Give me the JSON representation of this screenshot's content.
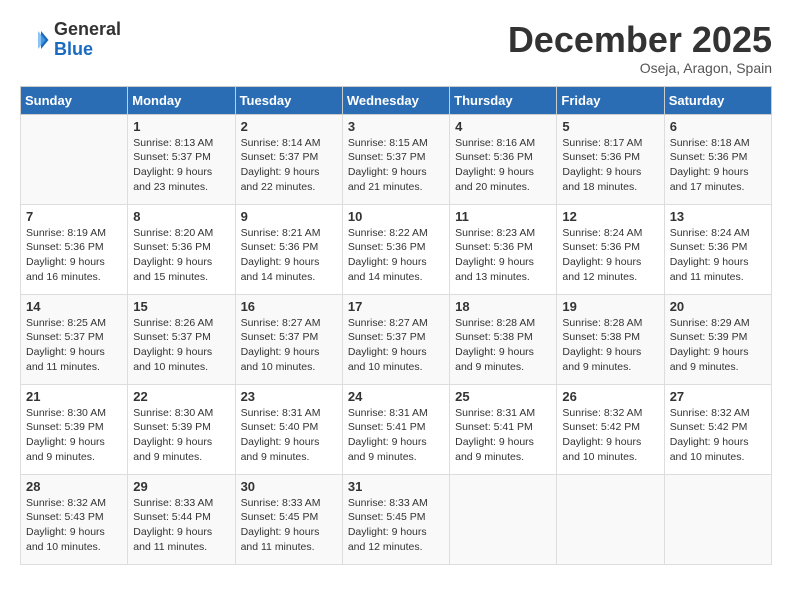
{
  "header": {
    "logo_general": "General",
    "logo_blue": "Blue",
    "month": "December 2025",
    "location": "Oseja, Aragon, Spain"
  },
  "days_of_week": [
    "Sunday",
    "Monday",
    "Tuesday",
    "Wednesday",
    "Thursday",
    "Friday",
    "Saturday"
  ],
  "weeks": [
    [
      {
        "day": "",
        "sunrise": "",
        "sunset": "",
        "daylight": ""
      },
      {
        "day": "1",
        "sunrise": "Sunrise: 8:13 AM",
        "sunset": "Sunset: 5:37 PM",
        "daylight": "Daylight: 9 hours and 23 minutes."
      },
      {
        "day": "2",
        "sunrise": "Sunrise: 8:14 AM",
        "sunset": "Sunset: 5:37 PM",
        "daylight": "Daylight: 9 hours and 22 minutes."
      },
      {
        "day": "3",
        "sunrise": "Sunrise: 8:15 AM",
        "sunset": "Sunset: 5:37 PM",
        "daylight": "Daylight: 9 hours and 21 minutes."
      },
      {
        "day": "4",
        "sunrise": "Sunrise: 8:16 AM",
        "sunset": "Sunset: 5:36 PM",
        "daylight": "Daylight: 9 hours and 20 minutes."
      },
      {
        "day": "5",
        "sunrise": "Sunrise: 8:17 AM",
        "sunset": "Sunset: 5:36 PM",
        "daylight": "Daylight: 9 hours and 18 minutes."
      },
      {
        "day": "6",
        "sunrise": "Sunrise: 8:18 AM",
        "sunset": "Sunset: 5:36 PM",
        "daylight": "Daylight: 9 hours and 17 minutes."
      }
    ],
    [
      {
        "day": "7",
        "sunrise": "Sunrise: 8:19 AM",
        "sunset": "Sunset: 5:36 PM",
        "daylight": "Daylight: 9 hours and 16 minutes."
      },
      {
        "day": "8",
        "sunrise": "Sunrise: 8:20 AM",
        "sunset": "Sunset: 5:36 PM",
        "daylight": "Daylight: 9 hours and 15 minutes."
      },
      {
        "day": "9",
        "sunrise": "Sunrise: 8:21 AM",
        "sunset": "Sunset: 5:36 PM",
        "daylight": "Daylight: 9 hours and 14 minutes."
      },
      {
        "day": "10",
        "sunrise": "Sunrise: 8:22 AM",
        "sunset": "Sunset: 5:36 PM",
        "daylight": "Daylight: 9 hours and 14 minutes."
      },
      {
        "day": "11",
        "sunrise": "Sunrise: 8:23 AM",
        "sunset": "Sunset: 5:36 PM",
        "daylight": "Daylight: 9 hours and 13 minutes."
      },
      {
        "day": "12",
        "sunrise": "Sunrise: 8:24 AM",
        "sunset": "Sunset: 5:36 PM",
        "daylight": "Daylight: 9 hours and 12 minutes."
      },
      {
        "day": "13",
        "sunrise": "Sunrise: 8:24 AM",
        "sunset": "Sunset: 5:36 PM",
        "daylight": "Daylight: 9 hours and 11 minutes."
      }
    ],
    [
      {
        "day": "14",
        "sunrise": "Sunrise: 8:25 AM",
        "sunset": "Sunset: 5:37 PM",
        "daylight": "Daylight: 9 hours and 11 minutes."
      },
      {
        "day": "15",
        "sunrise": "Sunrise: 8:26 AM",
        "sunset": "Sunset: 5:37 PM",
        "daylight": "Daylight: 9 hours and 10 minutes."
      },
      {
        "day": "16",
        "sunrise": "Sunrise: 8:27 AM",
        "sunset": "Sunset: 5:37 PM",
        "daylight": "Daylight: 9 hours and 10 minutes."
      },
      {
        "day": "17",
        "sunrise": "Sunrise: 8:27 AM",
        "sunset": "Sunset: 5:37 PM",
        "daylight": "Daylight: 9 hours and 10 minutes."
      },
      {
        "day": "18",
        "sunrise": "Sunrise: 8:28 AM",
        "sunset": "Sunset: 5:38 PM",
        "daylight": "Daylight: 9 hours and 9 minutes."
      },
      {
        "day": "19",
        "sunrise": "Sunrise: 8:28 AM",
        "sunset": "Sunset: 5:38 PM",
        "daylight": "Daylight: 9 hours and 9 minutes."
      },
      {
        "day": "20",
        "sunrise": "Sunrise: 8:29 AM",
        "sunset": "Sunset: 5:39 PM",
        "daylight": "Daylight: 9 hours and 9 minutes."
      }
    ],
    [
      {
        "day": "21",
        "sunrise": "Sunrise: 8:30 AM",
        "sunset": "Sunset: 5:39 PM",
        "daylight": "Daylight: 9 hours and 9 minutes."
      },
      {
        "day": "22",
        "sunrise": "Sunrise: 8:30 AM",
        "sunset": "Sunset: 5:39 PM",
        "daylight": "Daylight: 9 hours and 9 minutes."
      },
      {
        "day": "23",
        "sunrise": "Sunrise: 8:31 AM",
        "sunset": "Sunset: 5:40 PM",
        "daylight": "Daylight: 9 hours and 9 minutes."
      },
      {
        "day": "24",
        "sunrise": "Sunrise: 8:31 AM",
        "sunset": "Sunset: 5:41 PM",
        "daylight": "Daylight: 9 hours and 9 minutes."
      },
      {
        "day": "25",
        "sunrise": "Sunrise: 8:31 AM",
        "sunset": "Sunset: 5:41 PM",
        "daylight": "Daylight: 9 hours and 9 minutes."
      },
      {
        "day": "26",
        "sunrise": "Sunrise: 8:32 AM",
        "sunset": "Sunset: 5:42 PM",
        "daylight": "Daylight: 9 hours and 10 minutes."
      },
      {
        "day": "27",
        "sunrise": "Sunrise: 8:32 AM",
        "sunset": "Sunset: 5:42 PM",
        "daylight": "Daylight: 9 hours and 10 minutes."
      }
    ],
    [
      {
        "day": "28",
        "sunrise": "Sunrise: 8:32 AM",
        "sunset": "Sunset: 5:43 PM",
        "daylight": "Daylight: 9 hours and 10 minutes."
      },
      {
        "day": "29",
        "sunrise": "Sunrise: 8:33 AM",
        "sunset": "Sunset: 5:44 PM",
        "daylight": "Daylight: 9 hours and 11 minutes."
      },
      {
        "day": "30",
        "sunrise": "Sunrise: 8:33 AM",
        "sunset": "Sunset: 5:45 PM",
        "daylight": "Daylight: 9 hours and 11 minutes."
      },
      {
        "day": "31",
        "sunrise": "Sunrise: 8:33 AM",
        "sunset": "Sunset: 5:45 PM",
        "daylight": "Daylight: 9 hours and 12 minutes."
      },
      {
        "day": "",
        "sunrise": "",
        "sunset": "",
        "daylight": ""
      },
      {
        "day": "",
        "sunrise": "",
        "sunset": "",
        "daylight": ""
      },
      {
        "day": "",
        "sunrise": "",
        "sunset": "",
        "daylight": ""
      }
    ]
  ]
}
